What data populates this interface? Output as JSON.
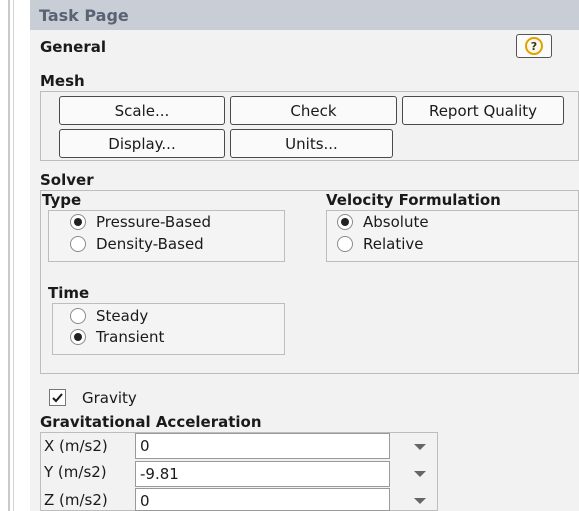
{
  "task_page": {
    "title": "Task Page"
  },
  "general": {
    "title": "General",
    "help_icon": "help-icon",
    "help_glyph": "?"
  },
  "mesh": {
    "label": "Mesh",
    "buttons": {
      "scale": "Scale...",
      "check": "Check",
      "report_quality": "Report Quality",
      "display": "Display...",
      "units": "Units..."
    }
  },
  "solver": {
    "label": "Solver",
    "type": {
      "label": "Type",
      "options": [
        "Pressure-Based",
        "Density-Based"
      ],
      "selected": "Pressure-Based"
    },
    "velocity_formulation": {
      "label": "Velocity Formulation",
      "options": [
        "Absolute",
        "Relative"
      ],
      "selected": "Absolute"
    },
    "time": {
      "label": "Time",
      "options": [
        "Steady",
        "Transient"
      ],
      "selected": "Transient"
    }
  },
  "gravity": {
    "label": "Gravity",
    "checked": true,
    "acceleration_label": "Gravitational Acceleration",
    "fields": [
      {
        "label": "X (m/s2)",
        "value": "0"
      },
      {
        "label": "Y (m/s2)",
        "value": "-9.81"
      },
      {
        "label": "Z (m/s2)",
        "value": "0"
      }
    ]
  },
  "colors": {
    "header_bg": "#c8cdd6",
    "header_text": "#5a6373",
    "panel_bg": "#f2f2f2",
    "help_ring": "#e0a100"
  }
}
